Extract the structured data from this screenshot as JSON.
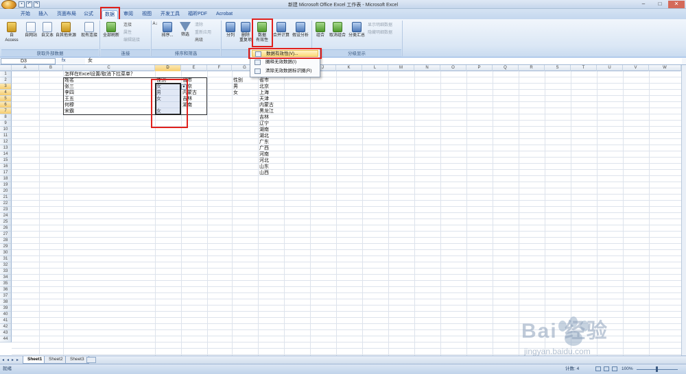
{
  "window": {
    "title": "新建 Microsoft Office Excel 工作表 - Microsoft Excel"
  },
  "tabs": [
    "开始",
    "插入",
    "页面布局",
    "公式",
    "数据",
    "审阅",
    "视图",
    "开发工具",
    "福昕PDF",
    "Acrobat"
  ],
  "active_tab": "数据",
  "ribbon": {
    "groups": {
      "external": "获取外部数据",
      "connections": "连接",
      "sort_filter": "排序和筛选",
      "data_tools": "数据工具",
      "outline": "分级显示"
    },
    "buttons": {
      "access": "自 Access",
      "web": "自网站",
      "text": "自文本",
      "other": "自其他来源",
      "existing": "现有连接",
      "refresh": "全部刷新",
      "conn": "连接",
      "props": "属性",
      "edit_links": "编辑链接",
      "sort": "排序...",
      "filter": "筛选",
      "clear": "清除",
      "reapply": "重新应用",
      "advanced": "高级",
      "split": "分列",
      "remove_dup": "删除\n重复项",
      "validation_1": "数据",
      "validation_2": "有效性",
      "consolidate": "合并计算",
      "what_if": "假设分析",
      "group": "组合",
      "ungroup": "取消组合",
      "subtotal": "分类汇总",
      "show_detail": "显示明细数据",
      "hide_detail": "隐藏明细数据"
    }
  },
  "validation_menu": {
    "items": [
      "数据有效性(V)...",
      "圈释无效数据(I)",
      "清除无效数据标识圈(R)"
    ]
  },
  "formula_bar": {
    "name_box": "D3",
    "fx": "fx",
    "value": "女"
  },
  "columns": [
    "A",
    "B",
    "C",
    "D",
    "E",
    "F",
    "G",
    "H",
    "I",
    "J",
    "K",
    "L",
    "M",
    "N",
    "O",
    "P",
    "Q",
    "R",
    "S",
    "T",
    "U",
    "V",
    "W"
  ],
  "rows": [
    "1",
    "2",
    "3",
    "4",
    "5",
    "6",
    "7",
    "8",
    "9",
    "10",
    "11",
    "12",
    "13",
    "14",
    "15",
    "16",
    "17",
    "18",
    "19",
    "20",
    "21",
    "22",
    "23",
    "24",
    "25",
    "26",
    "27",
    "28",
    "29",
    "30",
    "31",
    "32",
    "33",
    "34",
    "35",
    "36",
    "37",
    "38",
    "39",
    "40",
    "41",
    "42",
    "43",
    "44"
  ],
  "sheet": {
    "title_text": "怎样在Excel设置/取消下拉菜单？",
    "headers": {
      "name": "姓名",
      "gender": "性别",
      "province": "省市"
    },
    "people": [
      {
        "name": "张三",
        "gender": "女",
        "province": "北京"
      },
      {
        "name": "李四",
        "gender": "男",
        "province": "内蒙古"
      },
      {
        "name": "王五",
        "gender": "女",
        "province": "吉林"
      },
      {
        "name": "何穆",
        "gender": "",
        "province": "湖南"
      },
      {
        "name": "宋霸",
        "gender": "女",
        "province": ""
      }
    ],
    "gender_list": {
      "header": "性别",
      "items": [
        "男",
        "女"
      ]
    },
    "province_list": {
      "header": "省市",
      "items": [
        "北京",
        "上海",
        "天津",
        "内蒙古",
        "黑龙江",
        "吉林",
        "辽宁",
        "湖南",
        "湖北",
        "广东",
        "广西",
        "河南",
        "河北",
        "山东",
        "山西"
      ]
    }
  },
  "sheet_tabs": [
    "Sheet1",
    "Sheet2",
    "Sheet3"
  ],
  "status": {
    "ready": "就绪",
    "count": "计数: 4",
    "zoom": "100%"
  },
  "watermark": {
    "brand": "Bai 经验",
    "url": "jingyan.baidu.com"
  }
}
